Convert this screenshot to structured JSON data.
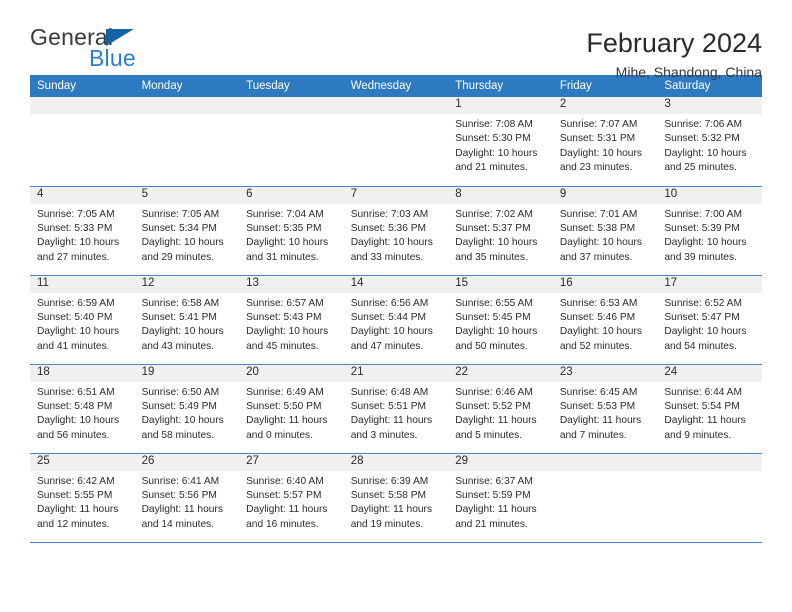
{
  "brand": {
    "name_part1": "General",
    "name_part2": "Blue",
    "accent_color": "#2a7fd4",
    "triangle_color": "#1464a5"
  },
  "header": {
    "title": "February 2024",
    "location": "Mihe, Shandong, China"
  },
  "calendar": {
    "header_bg": "#2d7ac0",
    "row_divider_color": "#4a87c7",
    "daynum_strip_bg": "#f0f0f0",
    "weekday_headers": [
      "Sunday",
      "Monday",
      "Tuesday",
      "Wednesday",
      "Thursday",
      "Friday",
      "Saturday"
    ],
    "weeks": [
      [
        {
          "day": "",
          "sunrise": "",
          "sunset": "",
          "daylight_line1": "",
          "daylight_line2": ""
        },
        {
          "day": "",
          "sunrise": "",
          "sunset": "",
          "daylight_line1": "",
          "daylight_line2": ""
        },
        {
          "day": "",
          "sunrise": "",
          "sunset": "",
          "daylight_line1": "",
          "daylight_line2": ""
        },
        {
          "day": "",
          "sunrise": "",
          "sunset": "",
          "daylight_line1": "",
          "daylight_line2": ""
        },
        {
          "day": "1",
          "sunrise": "Sunrise: 7:08 AM",
          "sunset": "Sunset: 5:30 PM",
          "daylight_line1": "Daylight: 10 hours",
          "daylight_line2": "and 21 minutes."
        },
        {
          "day": "2",
          "sunrise": "Sunrise: 7:07 AM",
          "sunset": "Sunset: 5:31 PM",
          "daylight_line1": "Daylight: 10 hours",
          "daylight_line2": "and 23 minutes."
        },
        {
          "day": "3",
          "sunrise": "Sunrise: 7:06 AM",
          "sunset": "Sunset: 5:32 PM",
          "daylight_line1": "Daylight: 10 hours",
          "daylight_line2": "and 25 minutes."
        }
      ],
      [
        {
          "day": "4",
          "sunrise": "Sunrise: 7:05 AM",
          "sunset": "Sunset: 5:33 PM",
          "daylight_line1": "Daylight: 10 hours",
          "daylight_line2": "and 27 minutes."
        },
        {
          "day": "5",
          "sunrise": "Sunrise: 7:05 AM",
          "sunset": "Sunset: 5:34 PM",
          "daylight_line1": "Daylight: 10 hours",
          "daylight_line2": "and 29 minutes."
        },
        {
          "day": "6",
          "sunrise": "Sunrise: 7:04 AM",
          "sunset": "Sunset: 5:35 PM",
          "daylight_line1": "Daylight: 10 hours",
          "daylight_line2": "and 31 minutes."
        },
        {
          "day": "7",
          "sunrise": "Sunrise: 7:03 AM",
          "sunset": "Sunset: 5:36 PM",
          "daylight_line1": "Daylight: 10 hours",
          "daylight_line2": "and 33 minutes."
        },
        {
          "day": "8",
          "sunrise": "Sunrise: 7:02 AM",
          "sunset": "Sunset: 5:37 PM",
          "daylight_line1": "Daylight: 10 hours",
          "daylight_line2": "and 35 minutes."
        },
        {
          "day": "9",
          "sunrise": "Sunrise: 7:01 AM",
          "sunset": "Sunset: 5:38 PM",
          "daylight_line1": "Daylight: 10 hours",
          "daylight_line2": "and 37 minutes."
        },
        {
          "day": "10",
          "sunrise": "Sunrise: 7:00 AM",
          "sunset": "Sunset: 5:39 PM",
          "daylight_line1": "Daylight: 10 hours",
          "daylight_line2": "and 39 minutes."
        }
      ],
      [
        {
          "day": "11",
          "sunrise": "Sunrise: 6:59 AM",
          "sunset": "Sunset: 5:40 PM",
          "daylight_line1": "Daylight: 10 hours",
          "daylight_line2": "and 41 minutes."
        },
        {
          "day": "12",
          "sunrise": "Sunrise: 6:58 AM",
          "sunset": "Sunset: 5:41 PM",
          "daylight_line1": "Daylight: 10 hours",
          "daylight_line2": "and 43 minutes."
        },
        {
          "day": "13",
          "sunrise": "Sunrise: 6:57 AM",
          "sunset": "Sunset: 5:43 PM",
          "daylight_line1": "Daylight: 10 hours",
          "daylight_line2": "and 45 minutes."
        },
        {
          "day": "14",
          "sunrise": "Sunrise: 6:56 AM",
          "sunset": "Sunset: 5:44 PM",
          "daylight_line1": "Daylight: 10 hours",
          "daylight_line2": "and 47 minutes."
        },
        {
          "day": "15",
          "sunrise": "Sunrise: 6:55 AM",
          "sunset": "Sunset: 5:45 PM",
          "daylight_line1": "Daylight: 10 hours",
          "daylight_line2": "and 50 minutes."
        },
        {
          "day": "16",
          "sunrise": "Sunrise: 6:53 AM",
          "sunset": "Sunset: 5:46 PM",
          "daylight_line1": "Daylight: 10 hours",
          "daylight_line2": "and 52 minutes."
        },
        {
          "day": "17",
          "sunrise": "Sunrise: 6:52 AM",
          "sunset": "Sunset: 5:47 PM",
          "daylight_line1": "Daylight: 10 hours",
          "daylight_line2": "and 54 minutes."
        }
      ],
      [
        {
          "day": "18",
          "sunrise": "Sunrise: 6:51 AM",
          "sunset": "Sunset: 5:48 PM",
          "daylight_line1": "Daylight: 10 hours",
          "daylight_line2": "and 56 minutes."
        },
        {
          "day": "19",
          "sunrise": "Sunrise: 6:50 AM",
          "sunset": "Sunset: 5:49 PM",
          "daylight_line1": "Daylight: 10 hours",
          "daylight_line2": "and 58 minutes."
        },
        {
          "day": "20",
          "sunrise": "Sunrise: 6:49 AM",
          "sunset": "Sunset: 5:50 PM",
          "daylight_line1": "Daylight: 11 hours",
          "daylight_line2": "and 0 minutes."
        },
        {
          "day": "21",
          "sunrise": "Sunrise: 6:48 AM",
          "sunset": "Sunset: 5:51 PM",
          "daylight_line1": "Daylight: 11 hours",
          "daylight_line2": "and 3 minutes."
        },
        {
          "day": "22",
          "sunrise": "Sunrise: 6:46 AM",
          "sunset": "Sunset: 5:52 PM",
          "daylight_line1": "Daylight: 11 hours",
          "daylight_line2": "and 5 minutes."
        },
        {
          "day": "23",
          "sunrise": "Sunrise: 6:45 AM",
          "sunset": "Sunset: 5:53 PM",
          "daylight_line1": "Daylight: 11 hours",
          "daylight_line2": "and 7 minutes."
        },
        {
          "day": "24",
          "sunrise": "Sunrise: 6:44 AM",
          "sunset": "Sunset: 5:54 PM",
          "daylight_line1": "Daylight: 11 hours",
          "daylight_line2": "and 9 minutes."
        }
      ],
      [
        {
          "day": "25",
          "sunrise": "Sunrise: 6:42 AM",
          "sunset": "Sunset: 5:55 PM",
          "daylight_line1": "Daylight: 11 hours",
          "daylight_line2": "and 12 minutes."
        },
        {
          "day": "26",
          "sunrise": "Sunrise: 6:41 AM",
          "sunset": "Sunset: 5:56 PM",
          "daylight_line1": "Daylight: 11 hours",
          "daylight_line2": "and 14 minutes."
        },
        {
          "day": "27",
          "sunrise": "Sunrise: 6:40 AM",
          "sunset": "Sunset: 5:57 PM",
          "daylight_line1": "Daylight: 11 hours",
          "daylight_line2": "and 16 minutes."
        },
        {
          "day": "28",
          "sunrise": "Sunrise: 6:39 AM",
          "sunset": "Sunset: 5:58 PM",
          "daylight_line1": "Daylight: 11 hours",
          "daylight_line2": "and 19 minutes."
        },
        {
          "day": "29",
          "sunrise": "Sunrise: 6:37 AM",
          "sunset": "Sunset: 5:59 PM",
          "daylight_line1": "Daylight: 11 hours",
          "daylight_line2": "and 21 minutes."
        },
        {
          "day": "",
          "sunrise": "",
          "sunset": "",
          "daylight_line1": "",
          "daylight_line2": ""
        },
        {
          "day": "",
          "sunrise": "",
          "sunset": "",
          "daylight_line1": "",
          "daylight_line2": ""
        }
      ]
    ]
  }
}
